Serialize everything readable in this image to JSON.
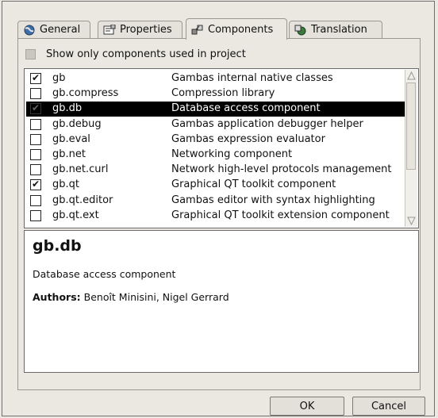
{
  "tabs": [
    {
      "label": "General",
      "icon": "globe-icon"
    },
    {
      "label": "Properties",
      "icon": "properties-icon"
    },
    {
      "label": "Components",
      "icon": "components-icon",
      "active": true
    },
    {
      "label": "Translation",
      "icon": "translation-icon"
    }
  ],
  "show_only": {
    "label": "Show only components used in project",
    "checked": false
  },
  "components": [
    {
      "name": "gb",
      "description": "Gambas internal native classes",
      "checked": true
    },
    {
      "name": "gb.compress",
      "description": "Compression library",
      "checked": false
    },
    {
      "name": "gb.db",
      "description": "Database access component",
      "checked": true,
      "selected": true
    },
    {
      "name": "gb.debug",
      "description": "Gambas application debugger helper",
      "checked": false
    },
    {
      "name": "gb.eval",
      "description": "Gambas expression evaluator",
      "checked": false
    },
    {
      "name": "gb.net",
      "description": "Networking component",
      "checked": false
    },
    {
      "name": "gb.net.curl",
      "description": "Network high-level protocols management",
      "checked": false
    },
    {
      "name": "gb.qt",
      "description": "Graphical QT toolkit component",
      "checked": true
    },
    {
      "name": "gb.qt.editor",
      "description": "Gambas editor with syntax highlighting",
      "checked": false
    },
    {
      "name": "gb.qt.ext",
      "description": "Graphical QT toolkit extension component",
      "checked": false
    }
  ],
  "detail": {
    "title": "gb.db",
    "description": "Database access component",
    "authors_label": "Authors:",
    "authors": "Benoît Minisini, Nigel Gerrard"
  },
  "buttons": {
    "ok": "OK",
    "cancel": "Cancel"
  },
  "colors": {
    "selection": "#000000",
    "background": "#eae8e1"
  }
}
